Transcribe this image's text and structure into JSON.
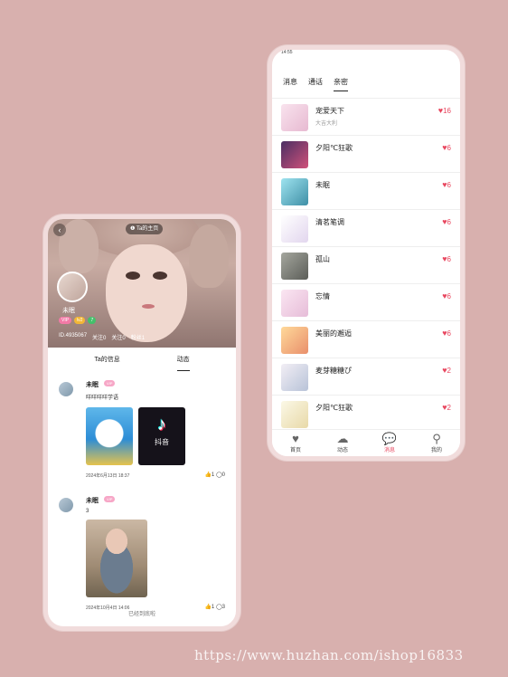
{
  "left_phone": {
    "follow_pill": "❶ Ta的主页",
    "username": "未眠",
    "badges": [
      "VIP",
      "lv2",
      "7"
    ],
    "stats": [
      "ID.4935067",
      "关注0",
      "关注0",
      "粉丝1"
    ],
    "tabs": [
      "Ta的信息",
      "动态"
    ],
    "active_tab": "动态",
    "posts": [
      {
        "name": "未眠",
        "vip": "VIP",
        "text": "咩咩咩咩学语",
        "tiktok_word": "抖音",
        "time": "2024年6月13日 18:37",
        "likes": "1",
        "comments": "0"
      },
      {
        "name": "未眠",
        "vip": "VIP",
        "text": "3",
        "time": "2024年10月4日 14:06",
        "likes": "1",
        "comments": "3"
      }
    ],
    "end_note": "已经到底啦"
  },
  "right_phone": {
    "status": "14:55",
    "tabs": [
      "消息",
      "通话",
      "亲密"
    ],
    "active_tab": "亲密",
    "rows": [
      {
        "name": "宠爱天下",
        "sub": "大吉大利",
        "score": "16",
        "color": "#f3d6e6"
      },
      {
        "name": "夕阳℃狂歌",
        "sub": "",
        "score": "6",
        "color": "#3a2b4f"
      },
      {
        "name": "未眠",
        "sub": "",
        "score": "6",
        "color": "#7fc7d6"
      },
      {
        "name": "清茗笔调",
        "sub": "",
        "score": "6",
        "color": "#efe6f2"
      },
      {
        "name": "孤山",
        "sub": "",
        "score": "6",
        "color": "#8a8a84"
      },
      {
        "name": "忘情",
        "sub": "",
        "score": "6",
        "color": "#f2d7ea"
      },
      {
        "name": "美丽的邂逅",
        "sub": "",
        "score": "6",
        "color": "#f5c98a"
      },
      {
        "name": "麦芽糖糖ぴ",
        "sub": "",
        "score": "2",
        "color": "#e2dde6"
      },
      {
        "name": "夕阳℃狂歌",
        "sub": "",
        "score": "2",
        "color": "#f1efd7"
      }
    ],
    "nav": [
      {
        "label": "首页",
        "icon": "heart-icon"
      },
      {
        "label": "动态",
        "icon": "cloud-icon"
      },
      {
        "label": "消息",
        "icon": "chat-icon"
      },
      {
        "label": "我的",
        "icon": "user-icon"
      }
    ],
    "active_nav": "消息"
  },
  "watermark": "https://www.huzhan.com/ishop16833",
  "accent_color": "#e8475f",
  "background_color": "#d8b0ae"
}
